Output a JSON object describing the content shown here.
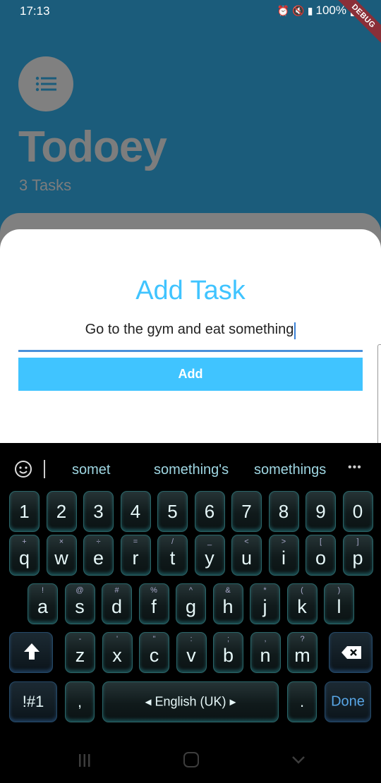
{
  "status_bar": {
    "time": "17:13",
    "battery": "100%",
    "debug_label": "DEBUG"
  },
  "app": {
    "title": "Todoey",
    "subtitle": "3 Tasks"
  },
  "sheet": {
    "title": "Add Task",
    "input_value": "Go to the gym and eat something",
    "add_label": "Add",
    "accent_color": "#40c4ff"
  },
  "keyboard": {
    "suggestions": [
      "somet",
      "something's",
      "somethings"
    ],
    "more": "•••",
    "number_row": [
      "1",
      "2",
      "3",
      "4",
      "5",
      "6",
      "7",
      "8",
      "9",
      "0"
    ],
    "row1": [
      {
        "k": "q",
        "h": "+"
      },
      {
        "k": "w",
        "h": "×"
      },
      {
        "k": "e",
        "h": "÷"
      },
      {
        "k": "r",
        "h": "="
      },
      {
        "k": "t",
        "h": "/"
      },
      {
        "k": "y",
        "h": "_"
      },
      {
        "k": "u",
        "h": "<"
      },
      {
        "k": "i",
        "h": ">"
      },
      {
        "k": "o",
        "h": "["
      },
      {
        "k": "p",
        "h": "]"
      }
    ],
    "row2": [
      {
        "k": "a",
        "h": "!"
      },
      {
        "k": "s",
        "h": "@"
      },
      {
        "k": "d",
        "h": "#"
      },
      {
        "k": "f",
        "h": "%"
      },
      {
        "k": "g",
        "h": "^"
      },
      {
        "k": "h",
        "h": "&"
      },
      {
        "k": "j",
        "h": "*"
      },
      {
        "k": "k",
        "h": "("
      },
      {
        "k": "l",
        "h": ")"
      }
    ],
    "row3": [
      {
        "k": "z",
        "h": "-"
      },
      {
        "k": "x",
        "h": "'"
      },
      {
        "k": "c",
        "h": "\""
      },
      {
        "k": "v",
        "h": ":"
      },
      {
        "k": "b",
        "h": ";"
      },
      {
        "k": "n",
        "h": ","
      },
      {
        "k": "m",
        "h": "?"
      }
    ],
    "symbols_label": "!#1",
    "comma": ",",
    "space_label": "◂  English (UK)  ▸",
    "period": ".",
    "done_label": "Done"
  }
}
